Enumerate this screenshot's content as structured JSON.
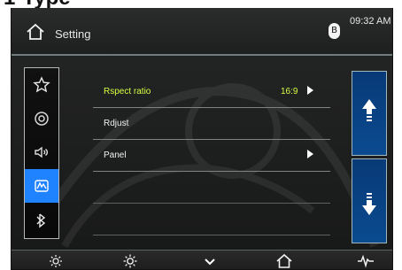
{
  "caption": {
    "text": "1-Type"
  },
  "header": {
    "title": "Setting",
    "time": "09:32 AM",
    "bluetooth_symbol": "B",
    "icons": {
      "home": "home-icon",
      "bluetooth": "bluetooth-icon"
    }
  },
  "sidebar": {
    "items": [
      {
        "icon": "star-icon",
        "active": false
      },
      {
        "icon": "disc-icon",
        "active": false
      },
      {
        "icon": "speaker-icon",
        "active": false
      },
      {
        "icon": "display-icon",
        "active": true
      },
      {
        "icon": "bluetooth-icon",
        "active": false
      }
    ]
  },
  "settings": {
    "rows": [
      {
        "label": "Rspect ratio",
        "value": "16:9",
        "has_arrow": true,
        "highlighted": true
      },
      {
        "label": "Rdjust",
        "value": "",
        "has_arrow": false,
        "highlighted": false
      },
      {
        "label": "Panel",
        "value": "",
        "has_arrow": true,
        "highlighted": false
      }
    ]
  },
  "buttons": {
    "scroll_up": "up-arrow-icon",
    "scroll_down": "down-arrow-icon"
  },
  "bottom_bar": {
    "items": [
      "settings-icon",
      "brightness-icon",
      "chevron-down-icon",
      "home-icon",
      "waveform-icon"
    ]
  },
  "colors": {
    "accent": "#1f82ff",
    "highlight_text": "#d7ff42",
    "screen_background": "#1d1e1e"
  }
}
